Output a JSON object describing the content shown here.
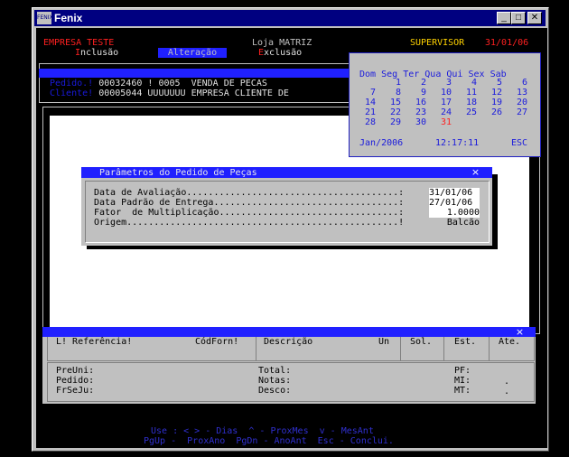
{
  "window": {
    "title": "Fenix",
    "icon_label": "FENIX",
    "minimize_glyph": "_",
    "maximize_glyph": "□",
    "close_glyph": "✕"
  },
  "header": {
    "company": "EMPRESA TESTE",
    "store": "Loja MATRIZ",
    "role": "SUPERVISOR",
    "date": "31/01/06",
    "modes": {
      "inclusion_hotkey": "I",
      "inclusion_rest": "nclusão",
      "alteration": "Alteração",
      "exclusion_hotkey": "E",
      "exclusion_rest": "xclusão"
    }
  },
  "order": {
    "pedido_label": "Pedido.!",
    "pedido_number": "00032460",
    "op_code": "! 0005",
    "op_desc": "VENDA DE PECAS",
    "cliente_label": "Cliente!",
    "cliente_code": "00005044",
    "cliente_name": "UUUUUUU EMPRESA CLIENTE DE"
  },
  "calendar": {
    "weekdays": [
      "Dom",
      "Seg",
      "Ter",
      "Qua",
      "Qui",
      "Sex",
      "Sab"
    ],
    "weeks": [
      [
        "",
        "1",
        "2",
        "3",
        "4",
        "5",
        "6"
      ],
      [
        "7",
        "8",
        "9",
        "10",
        "11",
        "12",
        "13"
      ],
      [
        "14",
        "15",
        "16",
        "17",
        "18",
        "19",
        "20"
      ],
      [
        "21",
        "22",
        "23",
        "24",
        "25",
        "26",
        "27"
      ],
      [
        "28",
        "29",
        "30",
        "31",
        "",
        "",
        ""
      ]
    ],
    "today": "31",
    "month_label": "Jan/2006",
    "time": "12:17:11",
    "esc_label": "ESC"
  },
  "dialog": {
    "title": "Parâmetros do Pedido de Peças",
    "close_glyph": "×",
    "rows": [
      {
        "label": "Data de Avaliação.......................................:",
        "value": "31/01/06"
      },
      {
        "label": "Data Padrão de Entrega..................................:",
        "value": "27/01/06"
      },
      {
        "label": "Fator  de Multiplicação.................................:",
        "value": "1.0000"
      },
      {
        "label": "Origem..................................................!",
        "value": "Balcão"
      }
    ]
  },
  "items_table": {
    "close_glyph": "×",
    "headers": {
      "ref": "L! Referência!",
      "codforn": "CódForn!",
      "descricao": "Descrição",
      "un": "Un",
      "sol": "Sol.",
      "est": "Est.",
      "ate": "Ate."
    },
    "footer": {
      "preuni": "PreUni:",
      "pedido": "Pedido:",
      "frseju": "FrSeJu:",
      "total": "Total:",
      "notas": "Notas:",
      "desco": "Desco:",
      "pf": "PF:",
      "mi": "MI:",
      "mt": "MT:",
      "mi_val": ".",
      "mt_val": "."
    }
  },
  "hints": {
    "line1": "Use : < > - Dias  ^ - ProxMes  v - MesAnt",
    "line2": "PgUp -  ProxAno  PgDn - AnoAnt  Esc - Conclui."
  }
}
